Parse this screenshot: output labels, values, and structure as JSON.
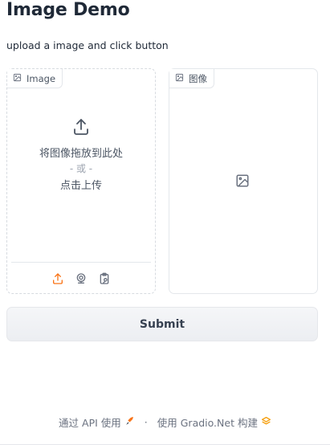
{
  "header": {
    "title": "Image Demo",
    "description": "upload a image and click button"
  },
  "input_panel": {
    "label": "Image",
    "drop_text": "将图像拖放到此处",
    "or_text": "- 或 -",
    "click_text": "点击上传",
    "sources": [
      "upload-icon",
      "webcam-icon",
      "clipboard-icon"
    ],
    "active_source_color": "#f97316"
  },
  "output_panel": {
    "label": "图像"
  },
  "submit_label": "Submit",
  "footer": {
    "api_text": "通过 API 使用",
    "built_text": "使用 Gradio.Net 构建",
    "separator": "·"
  },
  "colors": {
    "accent": "#f97316",
    "border": "#e4e7eb",
    "text": "#1f2937",
    "muted": "#6b7280"
  }
}
